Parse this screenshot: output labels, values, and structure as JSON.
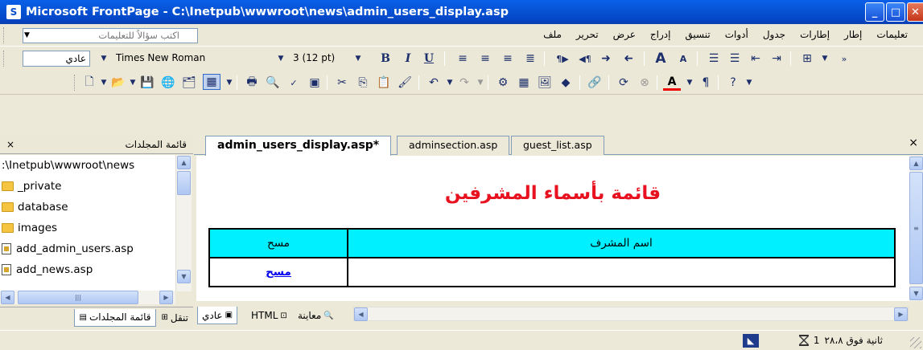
{
  "window": {
    "title": "Microsoft FrontPage - C:\\Inetpub\\wwwroot\\news\\admin_users_display.asp",
    "app_icon": "S",
    "minimize": "_",
    "maximize": "□",
    "close": "✕"
  },
  "menubar": {
    "ask_placeholder": "اكتب سؤالاً للتعليمات",
    "items": [
      "ملف",
      "تحرير",
      "عرض",
      "إدراج",
      "تنسيق",
      "أدوات",
      "جدول",
      "إطارات",
      "إطار",
      "تعليمات"
    ]
  },
  "format_toolbar": {
    "style": "عادي",
    "font": "Times New Roman",
    "size": "3  (12 pt)",
    "bold": "B",
    "italic": "I",
    "underline": "U"
  },
  "folder_panel": {
    "title": "قائمة المجلدات",
    "close": "×",
    "path": ":\\Inetpub\\wwwroot\\news",
    "items": [
      {
        "name": "_private",
        "type": "folder"
      },
      {
        "name": "database",
        "type": "folder"
      },
      {
        "name": "images",
        "type": "folder"
      },
      {
        "name": "add_admin_users.asp",
        "type": "file"
      },
      {
        "name": "add_news.asp",
        "type": "file"
      }
    ],
    "tabs": [
      "قائمة المجلدات",
      "تنقل"
    ]
  },
  "doc_tabs": {
    "tabs": [
      "admin_users_display.asp*",
      "adminsection.asp",
      "guest_list.asp"
    ],
    "close": "×"
  },
  "document": {
    "heading": "قائمة بأسماء المشرفين",
    "table": {
      "headers": [
        "اسم المشرف",
        "مسح"
      ],
      "rows": [
        [
          "",
          "مسح"
        ]
      ]
    }
  },
  "view_tabs": [
    "عادي",
    "HTML",
    "معاينة"
  ],
  "status": {
    "text": "ثانية فوق ٢٨،٨",
    "count": "1"
  }
}
